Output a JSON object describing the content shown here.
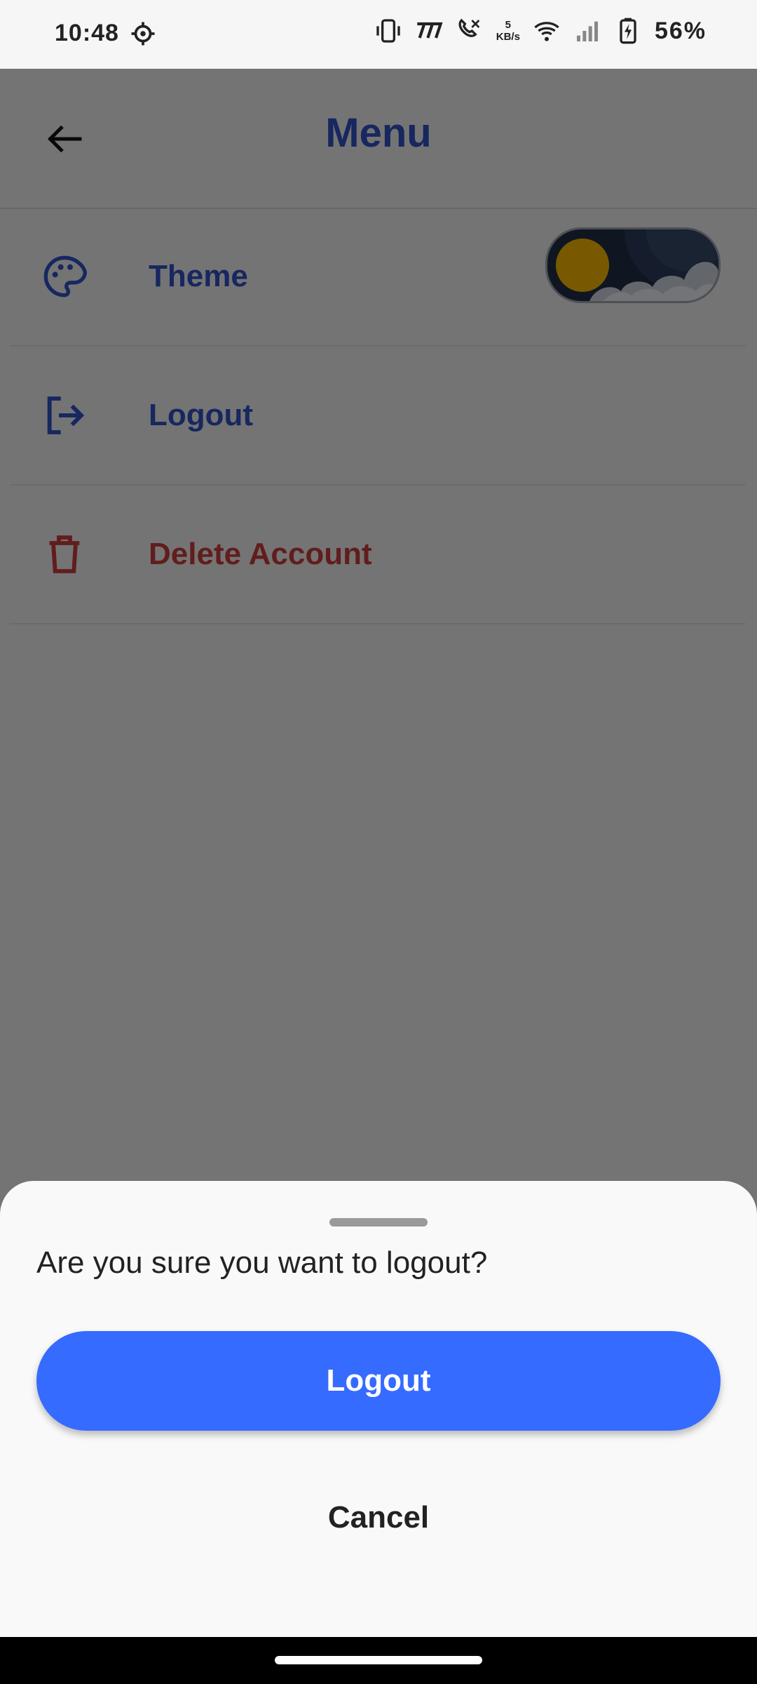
{
  "status_bar": {
    "time": "10:48",
    "net_speed_value": "5",
    "net_speed_unit": "KB/s",
    "battery_percent": "56%",
    "icons": [
      "settings-icon",
      "vibrate-icon",
      "carrier-icon",
      "call-icon",
      "wifi-icon",
      "signal-icon",
      "battery-charging-icon"
    ]
  },
  "appbar": {
    "title": "Menu",
    "back_icon": "arrow-left-icon"
  },
  "menu": {
    "items": [
      {
        "label": "Theme",
        "icon": "palette-icon"
      },
      {
        "label": "Logout",
        "icon": "logout-icon"
      },
      {
        "label": "Delete Account",
        "icon": "trash-icon"
      }
    ],
    "theme_toggle": {
      "state": "light",
      "knob": "sun"
    }
  },
  "sheet": {
    "question": "Are you sure you want to logout?",
    "confirm_label": "Logout",
    "cancel_label": "Cancel"
  },
  "colors": {
    "accent": "#2f4fbf",
    "danger": "#c23a3a",
    "primary_button": "#356bff"
  }
}
